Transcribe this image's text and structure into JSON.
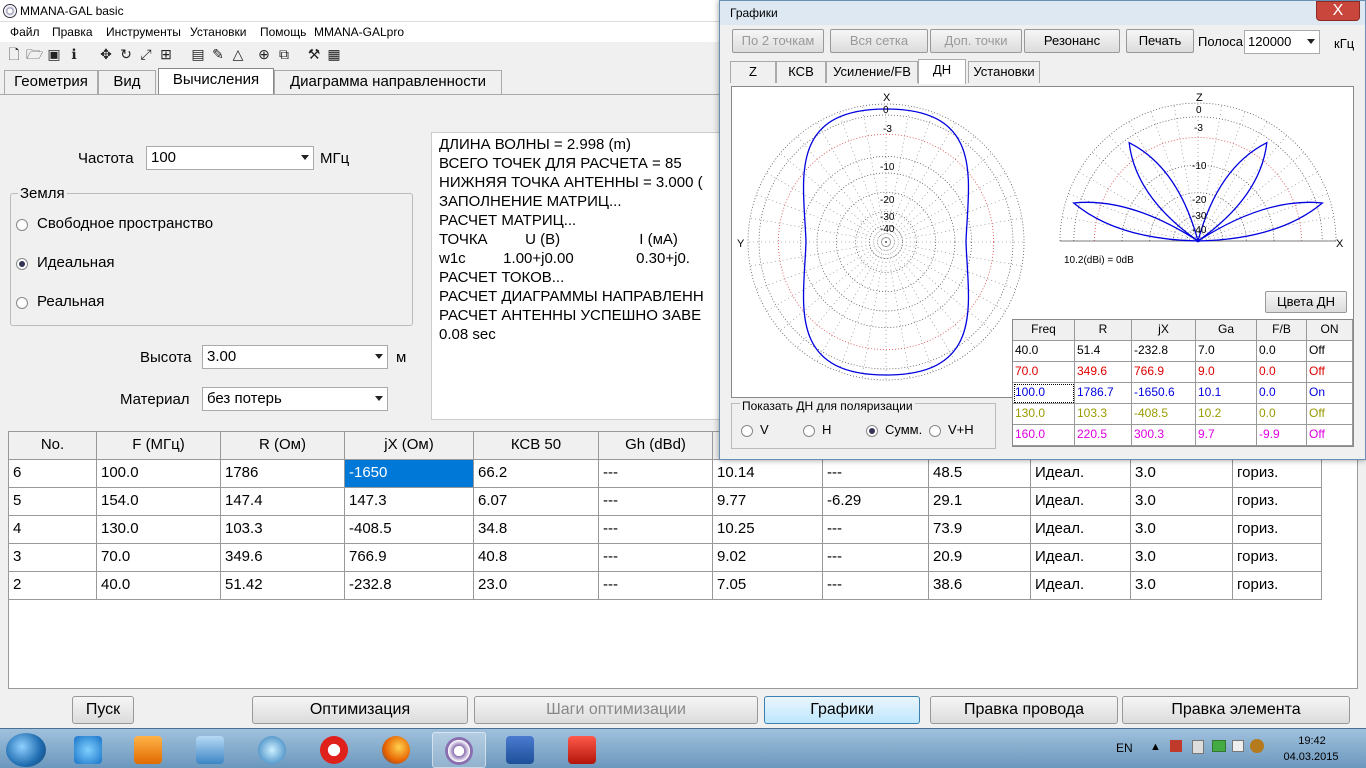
{
  "window": {
    "title": "MMANA-GAL basic"
  },
  "menu": [
    "Файл",
    "Правка",
    "Инструменты",
    "Установки",
    "Помощь",
    "MMANA-GALpro"
  ],
  "tabs": [
    "Геометрия",
    "Вид",
    "Вычисления",
    "Диаграмма направленности"
  ],
  "calc": {
    "freq_label": "Частота",
    "freq_value": "100",
    "freq_unit": "МГц",
    "ground_label": "Земля",
    "ground_options": [
      "Свободное пространство",
      "Идеальная",
      "Реальная"
    ],
    "ground_selected": "Идеальная",
    "height_label": "Высота",
    "height_value": "3.00",
    "height_unit": "м",
    "material_label": "Материал",
    "material_value": "без потерь"
  },
  "log": [
    "ДЛИНА ВОЛНЫ = 2.998 (m)",
    "ВСЕГО ТОЧЕК ДЛЯ РАСЧЕТА = 85",
    "НИЖНЯЯ ТОЧКА АНТЕННЫ = 3.000 (",
    "ЗАПОЛНЕНИЕ МАТРИЦ...",
    "РАСЧЕТ МАТРИЦ...",
    "ТОЧКА         U (В)                   I (мА)",
    "w1c         1.00+j0.00               0.30+j0.",
    "РАСЧЕТ ТОКОВ...",
    "РАСЧЕТ ДИАГРАММЫ НАПРАВЛЕНН",
    "РАСЧЕТ АНТЕННЫ УСПЕШНО ЗАВЕ",
    "0.08 sec"
  ],
  "table": {
    "headers": [
      "No.",
      "F (МГц)",
      "R (Ом)",
      "jX (Ом)",
      "КСВ 50",
      "Gh (dBd)",
      "",
      "",
      "",
      "",
      "",
      ""
    ],
    "rows": [
      [
        "6",
        "100.0",
        "1786",
        "-1650",
        "66.2",
        "---",
        "10.14",
        "---",
        "48.5",
        "Идеал.",
        "3.0",
        "гориз."
      ],
      [
        "5",
        "154.0",
        "147.4",
        "147.3",
        "6.07",
        "---",
        "9.77",
        "-6.29",
        "29.1",
        "Идеал.",
        "3.0",
        "гориз."
      ],
      [
        "4",
        "130.0",
        "103.3",
        "-408.5",
        "34.8",
        "---",
        "10.25",
        "---",
        "73.9",
        "Идеал.",
        "3.0",
        "гориз."
      ],
      [
        "3",
        "70.0",
        "349.6",
        "766.9",
        "40.8",
        "---",
        "9.02",
        "---",
        "20.9",
        "Идеал.",
        "3.0",
        "гориз."
      ],
      [
        "2",
        "40.0",
        "51.42",
        "-232.8",
        "23.0",
        "---",
        "7.05",
        "---",
        "38.6",
        "Идеал.",
        "3.0",
        "гориз."
      ]
    ]
  },
  "buttons": [
    "Пуск",
    "Оптимизация",
    "Шаги оптимизации",
    "Графики",
    "Правка провода",
    "Правка элемента"
  ],
  "graphs": {
    "title": "Графики",
    "close": "X",
    "top_buttons": [
      "По 2 точкам",
      "Вся сетка",
      "Доп. точки",
      "Резонанс",
      "Печать"
    ],
    "band_label": "Полоса",
    "band_value": "120000",
    "band_unit": "кГц",
    "tabs": [
      "Z",
      "КСВ",
      "Усиление/FB",
      "ДН",
      "Установки"
    ],
    "az_labels": {
      "top": "X",
      "left": "Y",
      "r0": "0",
      "r1": "-3",
      "r2": "-10",
      "r3": "-20",
      "r4": "-30",
      "r5": "-40"
    },
    "el_labels": {
      "top": "Z",
      "right": "X",
      "r0": "0",
      "r1": "-3",
      "r2": "-10",
      "r3": "-20",
      "r4": "-30",
      "r5": "-40"
    },
    "gain_note": "10.2(dBi) = 0dB",
    "colors_button": "Цвета ДН",
    "pol_label": "Показать ДН для поляризации",
    "pol_options": [
      "V",
      "H",
      "Сумм.",
      "V+H"
    ],
    "pol_selected": "Сумм.",
    "freq_table": {
      "headers": [
        "Freq",
        "R",
        "jX",
        "Ga",
        "F/B",
        "ON"
      ],
      "rows": [
        {
          "cells": [
            "40.0",
            "51.4",
            "-232.8",
            "7.0",
            "0.0",
            "Off"
          ],
          "color": "#000000"
        },
        {
          "cells": [
            "70.0",
            "349.6",
            "766.9",
            "9.0",
            "0.0",
            "Off"
          ],
          "color": "#e00000"
        },
        {
          "cells": [
            "100.0",
            "1786.7",
            "-1650.6",
            "10.1",
            "0.0",
            "On"
          ],
          "color": "#0000e0"
        },
        {
          "cells": [
            "130.0",
            "103.3",
            "-408.5",
            "10.2",
            "0.0",
            "Off"
          ],
          "color": "#9a9a00"
        },
        {
          "cells": [
            "160.0",
            "220.5",
            "300.3",
            "9.7",
            "-9.9",
            "Off"
          ],
          "color": "#e000e0"
        }
      ]
    }
  },
  "tray": {
    "lang": "EN",
    "time": "19:42",
    "date": "04.03.2015"
  }
}
